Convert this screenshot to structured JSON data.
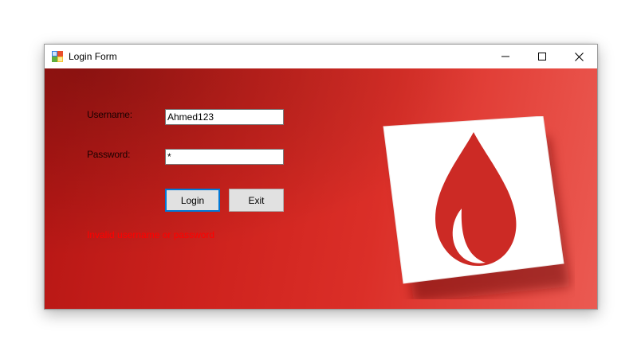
{
  "window": {
    "title": "Login Form",
    "icon": "windows-form-icon",
    "controls": {
      "minimize_icon": "minimize-icon",
      "maximize_icon": "maximize-icon",
      "close_icon": "close-icon"
    }
  },
  "form": {
    "username_label": "Username:",
    "username_value": "Ahmed123",
    "password_label": "Password:",
    "password_value": "*",
    "login_label": "Login",
    "exit_label": "Exit",
    "error_message": "Invalid username or password"
  },
  "decoration": {
    "icon": "blood-drop-note-icon"
  },
  "colors": {
    "background_red": "#d42a24",
    "error_text": "#ff0000",
    "focus_border": "#0078d7",
    "button_face": "#e1e1e1"
  }
}
